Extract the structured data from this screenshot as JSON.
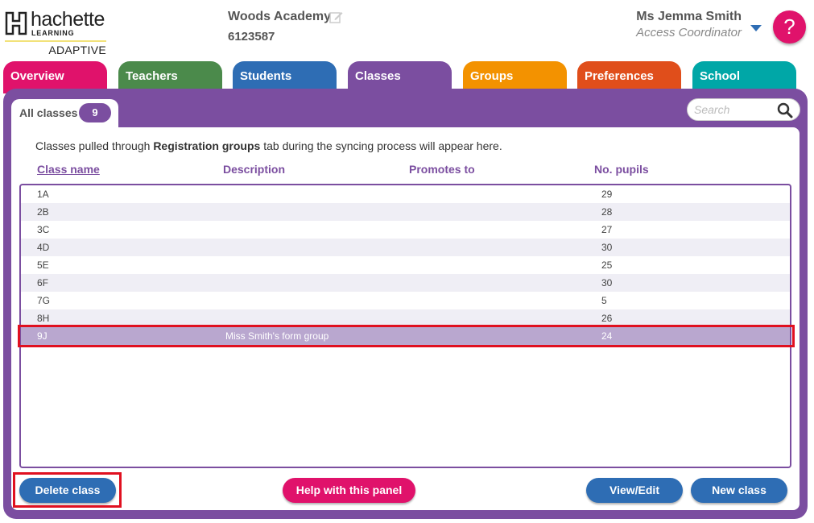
{
  "logo": {
    "brand": "hachette",
    "sub": "LEARNING",
    "product": "ADAPTIVE"
  },
  "school": {
    "name": "Woods Academy",
    "id": "6123587"
  },
  "user": {
    "name": "Ms Jemma Smith",
    "role": "Access Coordinator"
  },
  "help": {
    "label": "?"
  },
  "tabs": [
    {
      "label": "Overview",
      "color": "#e0126b"
    },
    {
      "label": "Teachers",
      "color": "#4b8a4b"
    },
    {
      "label": "Students",
      "color": "#2e6db4"
    },
    {
      "label": "Classes",
      "color": "#7b4ea0"
    },
    {
      "label": "Groups",
      "color": "#f39200"
    },
    {
      "label": "Preferences",
      "color": "#e04e1b"
    },
    {
      "label": "School",
      "color": "#00a7a7"
    }
  ],
  "subtab": {
    "label": "All classes",
    "count": "9"
  },
  "search": {
    "placeholder": "Search"
  },
  "info": {
    "before": "Classes pulled through ",
    "bold": "Registration groups",
    "after": " tab during the syncing process will appear here."
  },
  "columns": [
    "Class name",
    "Description",
    "Promotes to",
    "No. pupils"
  ],
  "rows": [
    {
      "name": "1A",
      "description": "",
      "promotes": "",
      "pupils": "29"
    },
    {
      "name": "2B",
      "description": "",
      "promotes": "",
      "pupils": "28"
    },
    {
      "name": "3C",
      "description": "",
      "promotes": "",
      "pupils": "27"
    },
    {
      "name": "4D",
      "description": "",
      "promotes": "",
      "pupils": "30"
    },
    {
      "name": "5E",
      "description": "",
      "promotes": "",
      "pupils": "25"
    },
    {
      "name": "6F",
      "description": "",
      "promotes": "",
      "pupils": "30"
    },
    {
      "name": "7G",
      "description": "",
      "promotes": "",
      "pupils": "5"
    },
    {
      "name": "8H",
      "description": "",
      "promotes": "",
      "pupils": "26"
    },
    {
      "name": "9J",
      "description": "Miss Smith's form group",
      "promotes": "",
      "pupils": "24"
    }
  ],
  "buttons": {
    "delete": "Delete class",
    "help": "Help with this panel",
    "view": "View/Edit",
    "new": "New class"
  },
  "colors": {
    "accent": "#7b4ea0",
    "primary_button": "#2e6db4",
    "help_button": "#e0126b",
    "highlight": "#e01020"
  }
}
